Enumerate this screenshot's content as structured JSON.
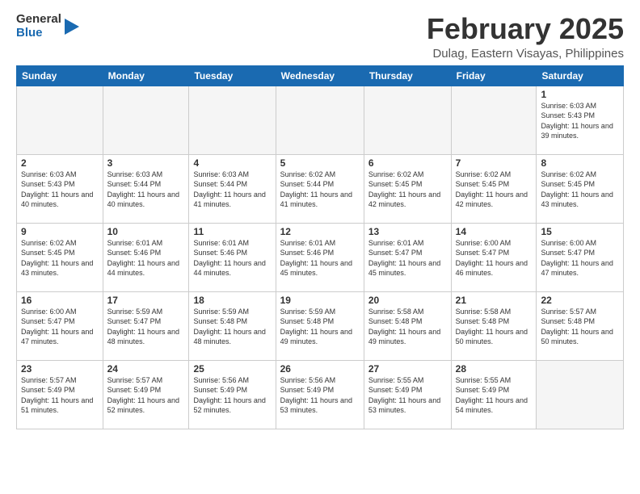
{
  "logo": {
    "general": "General",
    "blue": "Blue"
  },
  "header": {
    "month": "February 2025",
    "location": "Dulag, Eastern Visayas, Philippines"
  },
  "days_of_week": [
    "Sunday",
    "Monday",
    "Tuesday",
    "Wednesday",
    "Thursday",
    "Friday",
    "Saturday"
  ],
  "weeks": [
    [
      {
        "day": "",
        "empty": true
      },
      {
        "day": "",
        "empty": true
      },
      {
        "day": "",
        "empty": true
      },
      {
        "day": "",
        "empty": true
      },
      {
        "day": "",
        "empty": true
      },
      {
        "day": "",
        "empty": true
      },
      {
        "day": "1",
        "sunrise": "6:03 AM",
        "sunset": "5:43 PM",
        "daylight": "11 hours and 39 minutes."
      }
    ],
    [
      {
        "day": "2",
        "sunrise": "6:03 AM",
        "sunset": "5:43 PM",
        "daylight": "11 hours and 40 minutes."
      },
      {
        "day": "3",
        "sunrise": "6:03 AM",
        "sunset": "5:44 PM",
        "daylight": "11 hours and 40 minutes."
      },
      {
        "day": "4",
        "sunrise": "6:03 AM",
        "sunset": "5:44 PM",
        "daylight": "11 hours and 41 minutes."
      },
      {
        "day": "5",
        "sunrise": "6:02 AM",
        "sunset": "5:44 PM",
        "daylight": "11 hours and 41 minutes."
      },
      {
        "day": "6",
        "sunrise": "6:02 AM",
        "sunset": "5:45 PM",
        "daylight": "11 hours and 42 minutes."
      },
      {
        "day": "7",
        "sunrise": "6:02 AM",
        "sunset": "5:45 PM",
        "daylight": "11 hours and 42 minutes."
      },
      {
        "day": "8",
        "sunrise": "6:02 AM",
        "sunset": "5:45 PM",
        "daylight": "11 hours and 43 minutes."
      }
    ],
    [
      {
        "day": "9",
        "sunrise": "6:02 AM",
        "sunset": "5:45 PM",
        "daylight": "11 hours and 43 minutes."
      },
      {
        "day": "10",
        "sunrise": "6:01 AM",
        "sunset": "5:46 PM",
        "daylight": "11 hours and 44 minutes."
      },
      {
        "day": "11",
        "sunrise": "6:01 AM",
        "sunset": "5:46 PM",
        "daylight": "11 hours and 44 minutes."
      },
      {
        "day": "12",
        "sunrise": "6:01 AM",
        "sunset": "5:46 PM",
        "daylight": "11 hours and 45 minutes."
      },
      {
        "day": "13",
        "sunrise": "6:01 AM",
        "sunset": "5:47 PM",
        "daylight": "11 hours and 45 minutes."
      },
      {
        "day": "14",
        "sunrise": "6:00 AM",
        "sunset": "5:47 PM",
        "daylight": "11 hours and 46 minutes."
      },
      {
        "day": "15",
        "sunrise": "6:00 AM",
        "sunset": "5:47 PM",
        "daylight": "11 hours and 47 minutes."
      }
    ],
    [
      {
        "day": "16",
        "sunrise": "6:00 AM",
        "sunset": "5:47 PM",
        "daylight": "11 hours and 47 minutes."
      },
      {
        "day": "17",
        "sunrise": "5:59 AM",
        "sunset": "5:47 PM",
        "daylight": "11 hours and 48 minutes."
      },
      {
        "day": "18",
        "sunrise": "5:59 AM",
        "sunset": "5:48 PM",
        "daylight": "11 hours and 48 minutes."
      },
      {
        "day": "19",
        "sunrise": "5:59 AM",
        "sunset": "5:48 PM",
        "daylight": "11 hours and 49 minutes."
      },
      {
        "day": "20",
        "sunrise": "5:58 AM",
        "sunset": "5:48 PM",
        "daylight": "11 hours and 49 minutes."
      },
      {
        "day": "21",
        "sunrise": "5:58 AM",
        "sunset": "5:48 PM",
        "daylight": "11 hours and 50 minutes."
      },
      {
        "day": "22",
        "sunrise": "5:57 AM",
        "sunset": "5:48 PM",
        "daylight": "11 hours and 50 minutes."
      }
    ],
    [
      {
        "day": "23",
        "sunrise": "5:57 AM",
        "sunset": "5:49 PM",
        "daylight": "11 hours and 51 minutes."
      },
      {
        "day": "24",
        "sunrise": "5:57 AM",
        "sunset": "5:49 PM",
        "daylight": "11 hours and 52 minutes."
      },
      {
        "day": "25",
        "sunrise": "5:56 AM",
        "sunset": "5:49 PM",
        "daylight": "11 hours and 52 minutes."
      },
      {
        "day": "26",
        "sunrise": "5:56 AM",
        "sunset": "5:49 PM",
        "daylight": "11 hours and 53 minutes."
      },
      {
        "day": "27",
        "sunrise": "5:55 AM",
        "sunset": "5:49 PM",
        "daylight": "11 hours and 53 minutes."
      },
      {
        "day": "28",
        "sunrise": "5:55 AM",
        "sunset": "5:49 PM",
        "daylight": "11 hours and 54 minutes."
      },
      {
        "day": "",
        "empty": true
      }
    ]
  ]
}
